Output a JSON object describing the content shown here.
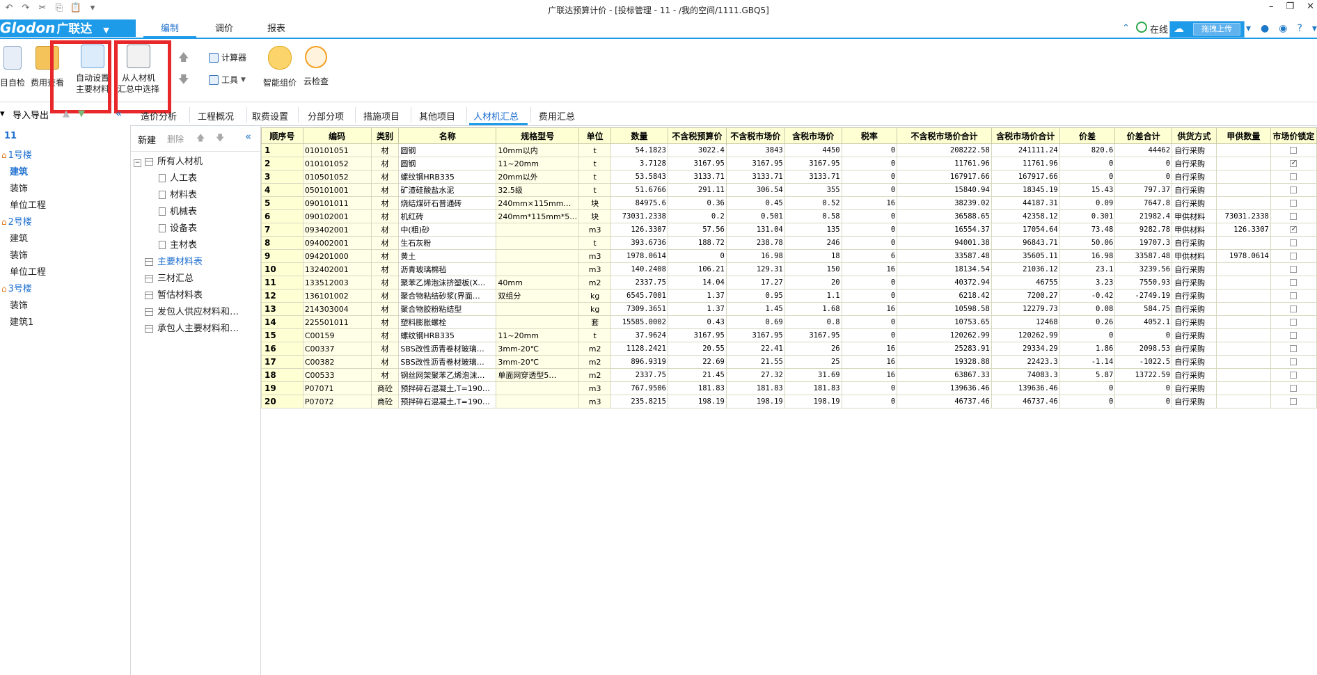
{
  "window": {
    "title": "广联达预算计价 - [投标管理 - 11 - /我的空间/1111.GBQ5]"
  },
  "quick_access": {
    "undo": "↶",
    "redo": "↷",
    "cut": "✂",
    "copy": "⎘",
    "paste": "📋",
    "more": "▾"
  },
  "logo": {
    "brand": "Glodon",
    "cn": "广联达"
  },
  "menu": {
    "tabs": [
      "编制",
      "调价",
      "报表"
    ],
    "online": "在线",
    "upload": "拖拽上传"
  },
  "ribbon": {
    "self_check": "目自检",
    "fee_view": "费用查看",
    "auto_set_line1": "自动设置",
    "auto_set_line2": "主要材料",
    "select_line1": "从人材机",
    "select_line2": "汇总中选择",
    "calculator": "计算器",
    "tools": "工具",
    "smart_price": "智能组价",
    "cloud_check": "云检查"
  },
  "left": {
    "import_export": "导入导出",
    "root": "11",
    "items": [
      "1号楼",
      "建筑",
      "装饰",
      "单位工程",
      "2号楼",
      "建筑",
      "装饰",
      "单位工程",
      "3号楼",
      "装饰",
      "建筑1"
    ]
  },
  "tabs": [
    "造价分析",
    "工程概况",
    "取费设置",
    "分部分项",
    "措施项目",
    "其他项目",
    "人材机汇总",
    "费用汇总"
  ],
  "panel2": {
    "new": "新建",
    "delete": "删除",
    "tree": [
      "所有人材机",
      "人工表",
      "材料表",
      "机械表",
      "设备表",
      "主材表",
      "主要材料表",
      "三材汇总",
      "暂估材料表",
      "发包人供应材料和…",
      "承包人主要材料和…"
    ]
  },
  "grid": {
    "headers": [
      "顺序号",
      "编码",
      "类别",
      "名称",
      "规格型号",
      "单位",
      "数量",
      "不含税预算价",
      "不含税市场价",
      "含税市场价",
      "税率",
      "不含税市场价合计",
      "含税市场价合计",
      "价差",
      "价差合计",
      "供货方式",
      "甲供数量",
      "市场价锁定"
    ],
    "rows": [
      [
        "1",
        "010101051",
        "材",
        "圆钢",
        "10mm以内",
        "t",
        "54.1823",
        "3022.4",
        "3843",
        "4450",
        "0",
        "208222.58",
        "241111.24",
        "820.6",
        "44462",
        "自行采购",
        "",
        false
      ],
      [
        "2",
        "010101052",
        "材",
        "圆钢",
        "11~20mm",
        "t",
        "3.7128",
        "3167.95",
        "3167.95",
        "3167.95",
        "0",
        "11761.96",
        "11761.96",
        "0",
        "0",
        "自行采购",
        "",
        true
      ],
      [
        "3",
        "010501052",
        "材",
        "螺纹钢HRB335",
        "20mm以外",
        "t",
        "53.5843",
        "3133.71",
        "3133.71",
        "3133.71",
        "0",
        "167917.66",
        "167917.66",
        "0",
        "0",
        "自行采购",
        "",
        false
      ],
      [
        "4",
        "050101001",
        "材",
        "矿渣硅酸盐水泥",
        "32.5级",
        "t",
        "51.6766",
        "291.11",
        "306.54",
        "355",
        "0",
        "15840.94",
        "18345.19",
        "15.43",
        "797.37",
        "自行采购",
        "",
        false
      ],
      [
        "5",
        "090101011",
        "材",
        "烧结煤矸石普通砖",
        "240mm×115mm…",
        "块",
        "84975.6",
        "0.36",
        "0.45",
        "0.52",
        "16",
        "38239.02",
        "44187.31",
        "0.09",
        "7647.8",
        "自行采购",
        "",
        false
      ],
      [
        "6",
        "090102001",
        "材",
        "机红砖",
        "240mm*115mm*5…",
        "块",
        "73031.2338",
        "0.2",
        "0.501",
        "0.58",
        "0",
        "36588.65",
        "42358.12",
        "0.301",
        "21982.4",
        "甲供材料",
        "73031.2338",
        false
      ],
      [
        "7",
        "093402001",
        "材",
        "中(粗)砂",
        "",
        "m3",
        "126.3307",
        "57.56",
        "131.04",
        "135",
        "0",
        "16554.37",
        "17054.64",
        "73.48",
        "9282.78",
        "甲供材料",
        "126.3307",
        true
      ],
      [
        "8",
        "094002001",
        "材",
        "生石灰粉",
        "",
        "t",
        "393.6736",
        "188.72",
        "238.78",
        "246",
        "0",
        "94001.38",
        "96843.71",
        "50.06",
        "19707.3",
        "自行采购",
        "",
        false
      ],
      [
        "9",
        "094201000",
        "材",
        "黄土",
        "",
        "m3",
        "1978.0614",
        "0",
        "16.98",
        "18",
        "6",
        "33587.48",
        "35605.11",
        "16.98",
        "33587.48",
        "甲供材料",
        "1978.0614",
        false
      ],
      [
        "10",
        "132402001",
        "材",
        "沥青玻璃棉毡",
        "",
        "m3",
        "140.2408",
        "106.21",
        "129.31",
        "150",
        "16",
        "18134.54",
        "21036.12",
        "23.1",
        "3239.56",
        "自行采购",
        "",
        false
      ],
      [
        "11",
        "133512003",
        "材",
        "聚苯乙烯泡沫挤塑板(X…",
        "40mm",
        "m2",
        "2337.75",
        "14.04",
        "17.27",
        "20",
        "0",
        "40372.94",
        "46755",
        "3.23",
        "7550.93",
        "自行采购",
        "",
        false
      ],
      [
        "12",
        "136101002",
        "材",
        "聚合物粘结砂浆(界面…",
        "双组分",
        "kg",
        "6545.7001",
        "1.37",
        "0.95",
        "1.1",
        "0",
        "6218.42",
        "7200.27",
        "-0.42",
        "-2749.19",
        "自行采购",
        "",
        false
      ],
      [
        "13",
        "214303004",
        "材",
        "聚合物胶粉粘结型",
        "",
        "kg",
        "7309.3651",
        "1.37",
        "1.45",
        "1.68",
        "16",
        "10598.58",
        "12279.73",
        "0.08",
        "584.75",
        "自行采购",
        "",
        false
      ],
      [
        "14",
        "225501011",
        "材",
        "塑料膨胀螺栓",
        "",
        "套",
        "15585.0002",
        "0.43",
        "0.69",
        "0.8",
        "0",
        "10753.65",
        "12468",
        "0.26",
        "4052.1",
        "自行采购",
        "",
        false
      ],
      [
        "15",
        "C00159",
        "材",
        "螺纹钢HRB335",
        "11~20mm",
        "t",
        "37.9624",
        "3167.95",
        "3167.95",
        "3167.95",
        "0",
        "120262.99",
        "120262.99",
        "0",
        "0",
        "自行采购",
        "",
        false
      ],
      [
        "16",
        "C00337",
        "材",
        "SBS改性沥青卷材玻璃…",
        "3mm-20℃",
        "m2",
        "1128.2421",
        "20.55",
        "22.41",
        "26",
        "16",
        "25283.91",
        "29334.29",
        "1.86",
        "2098.53",
        "自行采购",
        "",
        false
      ],
      [
        "17",
        "C00382",
        "材",
        "SBS改性沥青卷材玻璃…",
        "3mm-20℃",
        "m2",
        "896.9319",
        "22.69",
        "21.55",
        "25",
        "16",
        "19328.88",
        "22423.3",
        "-1.14",
        "-1022.5",
        "自行采购",
        "",
        false
      ],
      [
        "18",
        "C00533",
        "材",
        "钢丝网架聚苯乙烯泡沫…",
        "单面网穿透型5…",
        "m2",
        "2337.75",
        "21.45",
        "27.32",
        "31.69",
        "16",
        "63867.33",
        "74083.3",
        "5.87",
        "13722.59",
        "自行采购",
        "",
        false
      ],
      [
        "19",
        "P07071",
        "商砼",
        "预拌碎石混凝土,T=190…",
        "",
        "m3",
        "767.9506",
        "181.83",
        "181.83",
        "181.83",
        "0",
        "139636.46",
        "139636.46",
        "0",
        "0",
        "自行采购",
        "",
        false
      ],
      [
        "20",
        "P07072",
        "商砼",
        "预拌碎石混凝土,T=190…",
        "",
        "m3",
        "235.8215",
        "198.19",
        "198.19",
        "198.19",
        "0",
        "46737.46",
        "46737.46",
        "0",
        "0",
        "自行采购",
        "",
        false
      ]
    ]
  },
  "colors": {
    "accent": "#1e9be8",
    "header_bg": "#ffffd4",
    "highlight_red": "#e8272a"
  }
}
